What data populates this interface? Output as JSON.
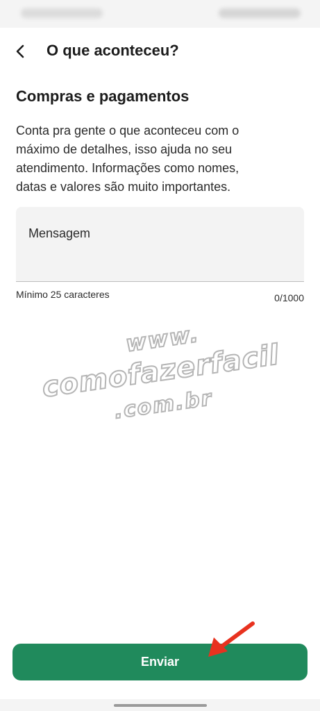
{
  "header": {
    "title": "O que aconteceu?",
    "back_icon": "chevron-left-icon"
  },
  "content": {
    "section_title": "Compras e pagamentos",
    "description_lines": [
      "Conta pra gente o que aconteceu com o",
      "máximo de detalhes, isso ajuda no seu",
      "atendimento. Informações como nomes,",
      "datas e valores são muito importantes."
    ]
  },
  "message": {
    "placeholder": "Mensagem",
    "value": "",
    "helper": "Mínimo 25 caracteres",
    "counter": "0/1000"
  },
  "watermark": {
    "line1": "www.",
    "line2": "comofazerfacil",
    "line3": ".com.br"
  },
  "actions": {
    "send_label": "Enviar",
    "send_color": "#208a5c"
  },
  "annotation": {
    "icon": "red-arrow-icon",
    "color": "#e8321f"
  }
}
